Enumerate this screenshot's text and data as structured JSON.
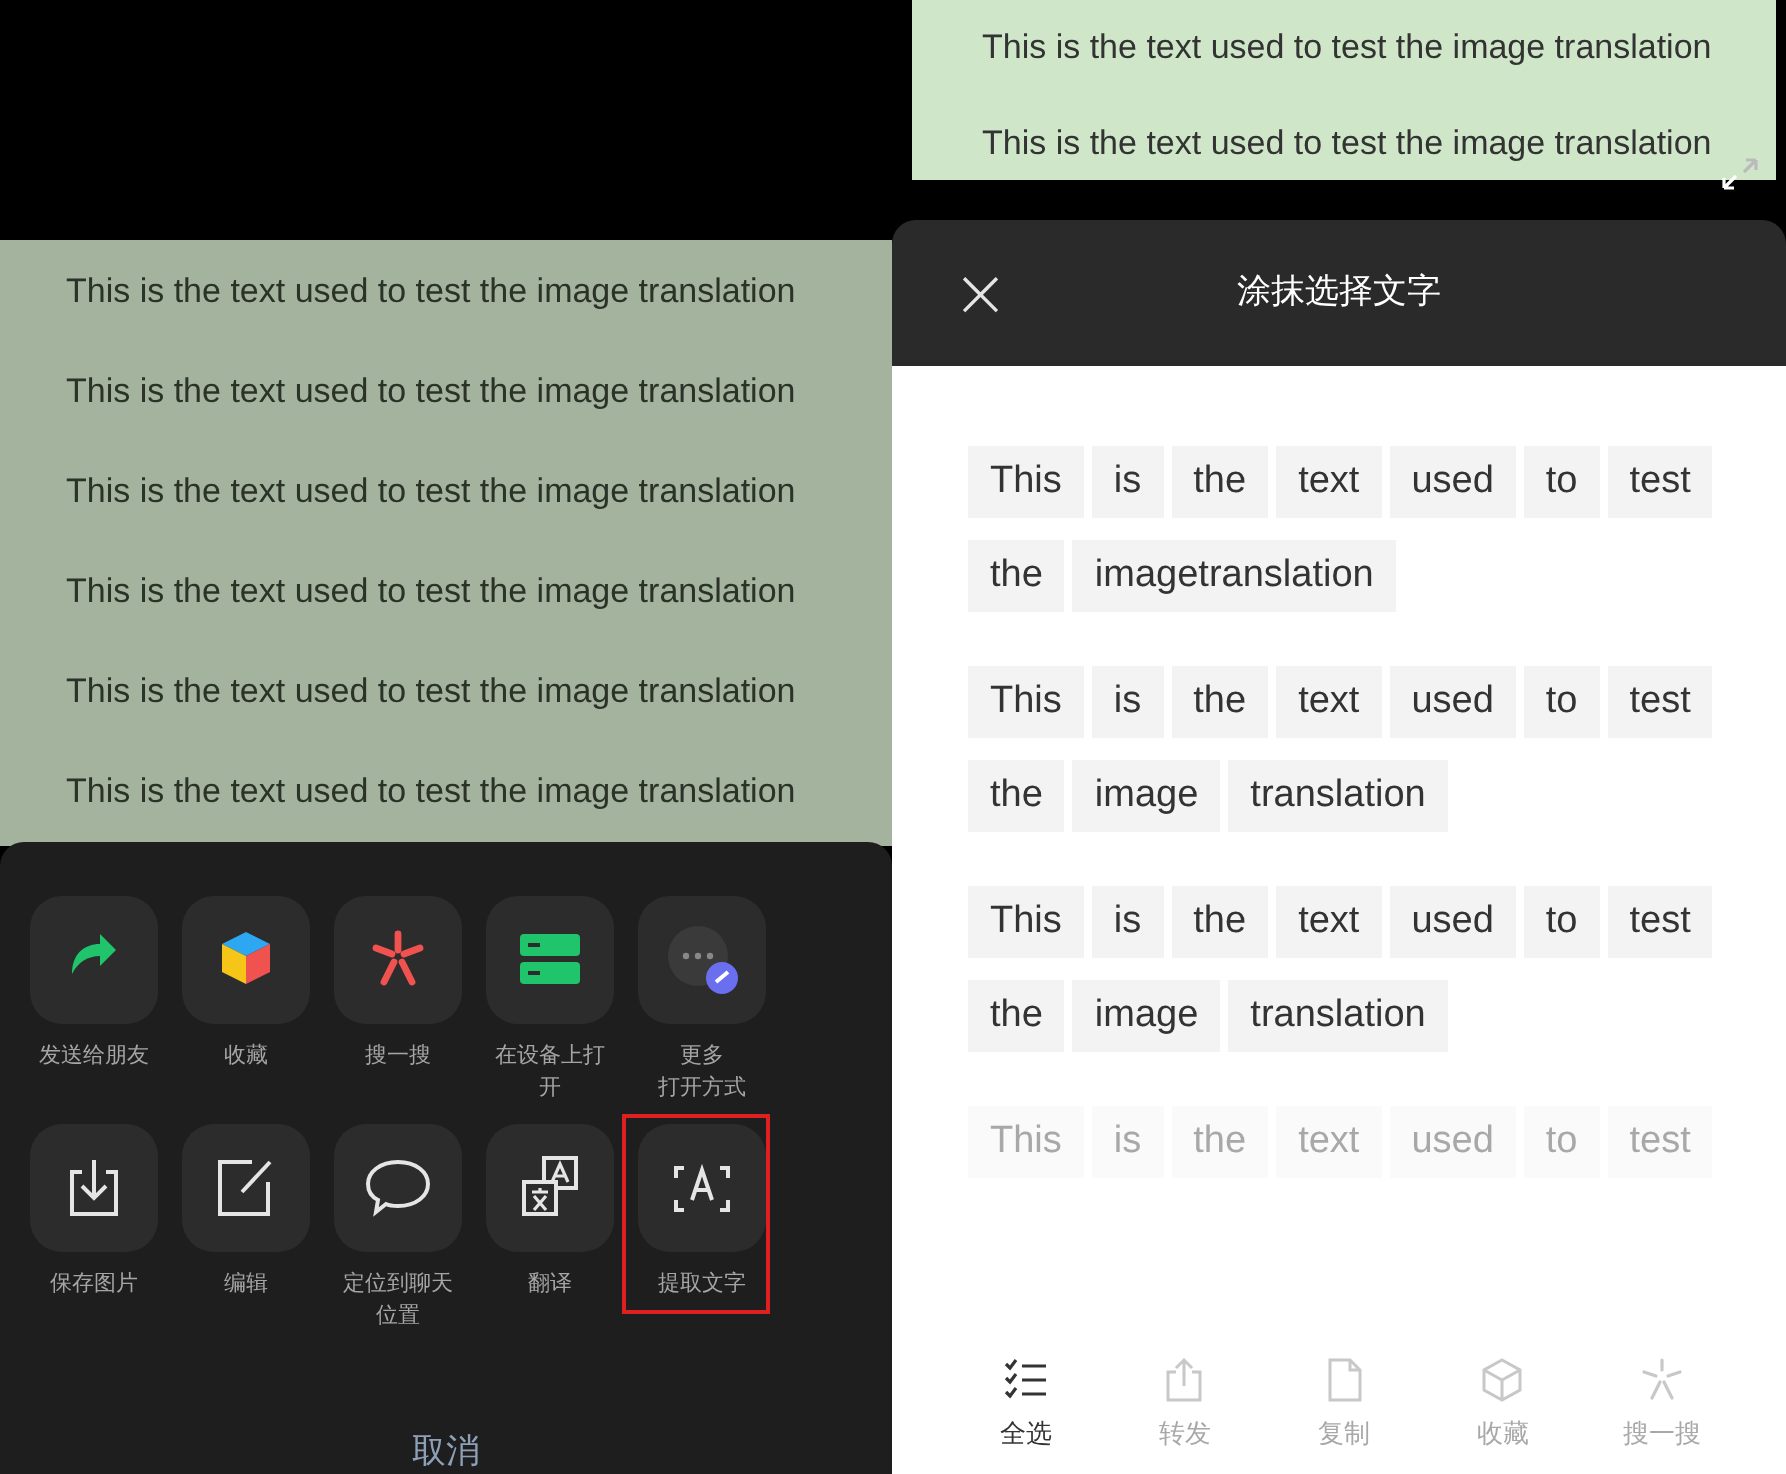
{
  "left": {
    "image_lines": [
      "This is the text used to test the image translation",
      "This is the text used to test the image translation",
      "This is the text used to test the image translation",
      "This is the text used to test the image translation",
      "This is the text used to test the image translation",
      "This is the text used to test the image translation"
    ],
    "share_sheet": {
      "rows": [
        [
          {
            "kind": "share",
            "label": "发送给朋友",
            "highlighted": false
          },
          {
            "kind": "favorite",
            "label": "收藏",
            "highlighted": false
          },
          {
            "kind": "search",
            "label": "搜一搜",
            "highlighted": false
          },
          {
            "kind": "device",
            "label": "在设备上打开",
            "highlighted": false
          },
          {
            "kind": "more",
            "label": "更多",
            "sublabel": "打开方式",
            "highlighted": false
          }
        ],
        [
          {
            "kind": "save",
            "label": "保存图片",
            "highlighted": false
          },
          {
            "kind": "edit",
            "label": "编辑",
            "highlighted": false
          },
          {
            "kind": "chat",
            "label": "定位到聊天位置",
            "highlighted": false
          },
          {
            "kind": "translate",
            "label": "翻译",
            "highlighted": false
          },
          {
            "kind": "extract",
            "label": "提取文字",
            "highlighted": true
          }
        ]
      ],
      "cancel": "取消"
    }
  },
  "right": {
    "image_lines": [
      "This is the text used to test the image translation",
      "This is the text used to test the image translation"
    ],
    "header": {
      "close": "×",
      "title": "涂抹选择文字"
    },
    "paragraphs": [
      {
        "faded": false,
        "lines": [
          [
            "This",
            "is",
            "the",
            "text",
            "used",
            "to",
            "test"
          ],
          [
            "the",
            "imagetranslation"
          ]
        ]
      },
      {
        "faded": false,
        "lines": [
          [
            "This",
            "is",
            "the",
            "text",
            "used",
            "to",
            "test"
          ],
          [
            "the",
            "image",
            "translation"
          ]
        ]
      },
      {
        "faded": false,
        "lines": [
          [
            "This",
            "is",
            "the",
            "text",
            "used",
            "to",
            "test"
          ],
          [
            "the",
            "image",
            "translation"
          ]
        ]
      },
      {
        "faded": true,
        "lines": [
          [
            "This",
            "is",
            "the",
            "text",
            "used",
            "to",
            "test"
          ]
        ]
      }
    ],
    "toolbar": [
      {
        "kind": "select_all",
        "label": "全选",
        "disabled": false
      },
      {
        "kind": "forward",
        "label": "转发",
        "disabled": true
      },
      {
        "kind": "copy",
        "label": "复制",
        "disabled": true
      },
      {
        "kind": "favorite",
        "label": "收藏",
        "disabled": true
      },
      {
        "kind": "search",
        "label": "搜一搜",
        "disabled": true
      }
    ]
  }
}
